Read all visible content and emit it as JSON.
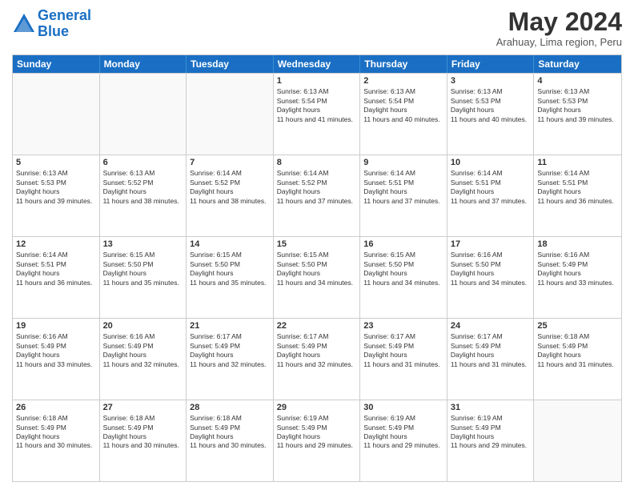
{
  "header": {
    "logo_line1": "General",
    "logo_line2": "Blue",
    "month": "May 2024",
    "location": "Arahuay, Lima region, Peru"
  },
  "weekdays": [
    "Sunday",
    "Monday",
    "Tuesday",
    "Wednesday",
    "Thursday",
    "Friday",
    "Saturday"
  ],
  "rows": [
    [
      {
        "day": "",
        "empty": true
      },
      {
        "day": "",
        "empty": true
      },
      {
        "day": "",
        "empty": true
      },
      {
        "day": "1",
        "rise": "6:13 AM",
        "set": "5:54 PM",
        "daylight": "11 hours and 41 minutes."
      },
      {
        "day": "2",
        "rise": "6:13 AM",
        "set": "5:54 PM",
        "daylight": "11 hours and 40 minutes."
      },
      {
        "day": "3",
        "rise": "6:13 AM",
        "set": "5:53 PM",
        "daylight": "11 hours and 40 minutes."
      },
      {
        "day": "4",
        "rise": "6:13 AM",
        "set": "5:53 PM",
        "daylight": "11 hours and 39 minutes."
      }
    ],
    [
      {
        "day": "5",
        "rise": "6:13 AM",
        "set": "5:53 PM",
        "daylight": "11 hours and 39 minutes."
      },
      {
        "day": "6",
        "rise": "6:13 AM",
        "set": "5:52 PM",
        "daylight": "11 hours and 38 minutes."
      },
      {
        "day": "7",
        "rise": "6:14 AM",
        "set": "5:52 PM",
        "daylight": "11 hours and 38 minutes."
      },
      {
        "day": "8",
        "rise": "6:14 AM",
        "set": "5:52 PM",
        "daylight": "11 hours and 37 minutes."
      },
      {
        "day": "9",
        "rise": "6:14 AM",
        "set": "5:51 PM",
        "daylight": "11 hours and 37 minutes."
      },
      {
        "day": "10",
        "rise": "6:14 AM",
        "set": "5:51 PM",
        "daylight": "11 hours and 37 minutes."
      },
      {
        "day": "11",
        "rise": "6:14 AM",
        "set": "5:51 PM",
        "daylight": "11 hours and 36 minutes."
      }
    ],
    [
      {
        "day": "12",
        "rise": "6:14 AM",
        "set": "5:51 PM",
        "daylight": "11 hours and 36 minutes."
      },
      {
        "day": "13",
        "rise": "6:15 AM",
        "set": "5:50 PM",
        "daylight": "11 hours and 35 minutes."
      },
      {
        "day": "14",
        "rise": "6:15 AM",
        "set": "5:50 PM",
        "daylight": "11 hours and 35 minutes."
      },
      {
        "day": "15",
        "rise": "6:15 AM",
        "set": "5:50 PM",
        "daylight": "11 hours and 34 minutes."
      },
      {
        "day": "16",
        "rise": "6:15 AM",
        "set": "5:50 PM",
        "daylight": "11 hours and 34 minutes."
      },
      {
        "day": "17",
        "rise": "6:16 AM",
        "set": "5:50 PM",
        "daylight": "11 hours and 34 minutes."
      },
      {
        "day": "18",
        "rise": "6:16 AM",
        "set": "5:49 PM",
        "daylight": "11 hours and 33 minutes."
      }
    ],
    [
      {
        "day": "19",
        "rise": "6:16 AM",
        "set": "5:49 PM",
        "daylight": "11 hours and 33 minutes."
      },
      {
        "day": "20",
        "rise": "6:16 AM",
        "set": "5:49 PM",
        "daylight": "11 hours and 32 minutes."
      },
      {
        "day": "21",
        "rise": "6:17 AM",
        "set": "5:49 PM",
        "daylight": "11 hours and 32 minutes."
      },
      {
        "day": "22",
        "rise": "6:17 AM",
        "set": "5:49 PM",
        "daylight": "11 hours and 32 minutes."
      },
      {
        "day": "23",
        "rise": "6:17 AM",
        "set": "5:49 PM",
        "daylight": "11 hours and 31 minutes."
      },
      {
        "day": "24",
        "rise": "6:17 AM",
        "set": "5:49 PM",
        "daylight": "11 hours and 31 minutes."
      },
      {
        "day": "25",
        "rise": "6:18 AM",
        "set": "5:49 PM",
        "daylight": "11 hours and 31 minutes."
      }
    ],
    [
      {
        "day": "26",
        "rise": "6:18 AM",
        "set": "5:49 PM",
        "daylight": "11 hours and 30 minutes."
      },
      {
        "day": "27",
        "rise": "6:18 AM",
        "set": "5:49 PM",
        "daylight": "11 hours and 30 minutes."
      },
      {
        "day": "28",
        "rise": "6:18 AM",
        "set": "5:49 PM",
        "daylight": "11 hours and 30 minutes."
      },
      {
        "day": "29",
        "rise": "6:19 AM",
        "set": "5:49 PM",
        "daylight": "11 hours and 29 minutes."
      },
      {
        "day": "30",
        "rise": "6:19 AM",
        "set": "5:49 PM",
        "daylight": "11 hours and 29 minutes."
      },
      {
        "day": "31",
        "rise": "6:19 AM",
        "set": "5:49 PM",
        "daylight": "11 hours and 29 minutes."
      },
      {
        "day": "",
        "empty": true
      }
    ]
  ]
}
